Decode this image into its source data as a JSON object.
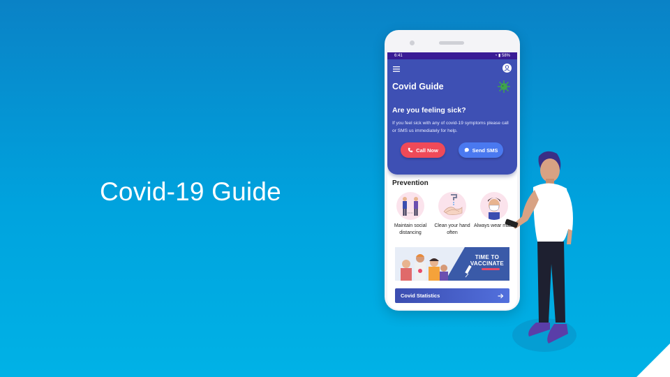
{
  "slide": {
    "title": "Covid-19 Guide"
  },
  "status_bar": {
    "time": "6:41",
    "battery": "58%"
  },
  "app": {
    "title": "Covid Guide",
    "question": "Are you feeling sick?",
    "description": "If you feel sick with any of covid-19 symptoms please call or SMS us immediately for help.",
    "call_button": "Call Now",
    "sms_button": "Send SMS",
    "prevention_title": "Prevention",
    "prevention_items": [
      {
        "label": "Maintain social distancing",
        "icon": "social-distancing-icon"
      },
      {
        "label": "Clean your hand often",
        "icon": "hand-washing-icon"
      },
      {
        "label": "Always wear mask",
        "icon": "face-mask-icon"
      }
    ],
    "banner": {
      "line1": "TIME TO",
      "line2": "VACCINATE"
    },
    "stats_button": "Covid Statistics"
  },
  "colors": {
    "background": "#00a3de",
    "primary": "#3e50b4",
    "status_bar": "#3a1c96",
    "call": "#ef4a58",
    "sms": "#4a79f0"
  }
}
